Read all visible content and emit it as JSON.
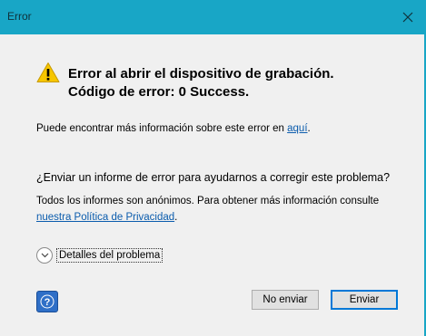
{
  "window": {
    "title": "Error",
    "close_icon": "close-icon",
    "accent_color": "#18a6c6"
  },
  "error": {
    "icon": "warning-icon",
    "title_line1": "Error al abrir el dispositivo de grabación.",
    "title_line2": "Código de error: 0 Success."
  },
  "info": {
    "text": "Puede encontrar más información sobre este error en ",
    "link": "aquí",
    "suffix": "."
  },
  "report": {
    "question": "¿Enviar un informe de error para ayudarnos a corregir este problema?",
    "anonymous_text": "Todos los informes son anónimos. Para obtener más información consulte",
    "privacy_link": "nuestra Política de Privacidad",
    "privacy_suffix": "."
  },
  "details": {
    "icon": "chevron-down-icon",
    "label": "Detalles del problema"
  },
  "buttons": {
    "help_icon": "help-icon",
    "no_send": "No enviar",
    "send": "Enviar"
  }
}
